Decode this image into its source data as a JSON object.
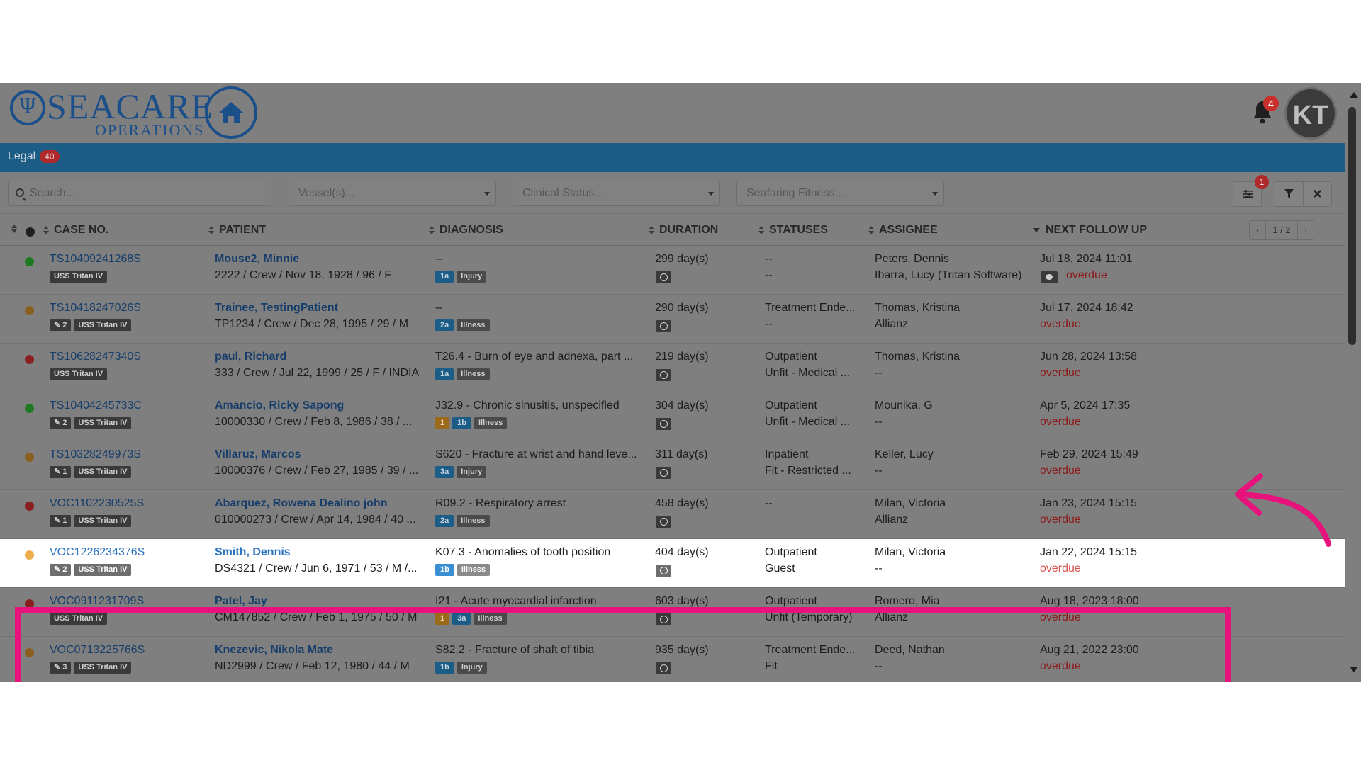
{
  "app": {
    "logo_text": "SEACARE",
    "logo_subtext": "OPERATIONS",
    "notifications_count": "4",
    "avatar_initials": "KT"
  },
  "tabs": [
    {
      "label": "Legal",
      "count": "40"
    }
  ],
  "filters": {
    "search_placeholder": "Search...",
    "vessel_placeholder": "Vessel(s)...",
    "clinical_placeholder": "Clinical Status...",
    "fitness_placeholder": "Seafaring Fitness...",
    "settings_badge": "1"
  },
  "table": {
    "columns": [
      "CASE NO.",
      "PATIENT",
      "DIAGNOSIS",
      "DURATION",
      "STATUSES",
      "ASSIGNEE",
      "NEXT FOLLOW UP"
    ],
    "pager": {
      "label": "1 / 2",
      "prev": "‹",
      "next": "›"
    },
    "rows": [
      {
        "dot_color": "#1e7a1e",
        "case": "TS10409241268S",
        "tags": [
          "USS Tritan IV"
        ],
        "patient": "Mouse2, Minnie",
        "patient_info": "2222 / Crew / Nov 18, 1928 / 96 / F",
        "diagnosis": "--",
        "severity": [
          "1a"
        ],
        "category": "Injury",
        "duration": "299 day(s)",
        "status1": "--",
        "status2": "--",
        "assignee1": "Peters, Dennis",
        "assignee2": "Ibarra, Lucy (Tritan Software)",
        "next_follow_up": "Jul 18, 2024 11:01",
        "overdue": "overdue",
        "has_chat": true
      },
      {
        "dot_color": "#8a5e1f",
        "case": "TS10418247026S",
        "tags": [
          "✎ 2",
          "USS Tritan IV"
        ],
        "patient": "Trainee, TestingPatient",
        "patient_info": "TP1234 / Crew / Dec 28, 1995 / 29 / M",
        "diagnosis": "--",
        "severity": [
          "2a"
        ],
        "category": "Illness",
        "duration": "290 day(s)",
        "status1": "Treatment Ende...",
        "status2": "--",
        "assignee1": "Thomas, Kristina",
        "assignee2": "Allianz",
        "next_follow_up": "Jul 17, 2024 18:42",
        "overdue": "overdue",
        "has_chat": false
      },
      {
        "dot_color": "#8a1f1f",
        "case": "TS10628247340S",
        "tags": [
          "USS Tritan IV"
        ],
        "patient": "paul, Richard",
        "patient_info": "333 / Crew / Jul 22, 1999 / 25 / F / INDIA",
        "diagnosis": "T26.4 - Burn of eye and adnexa, part ...",
        "severity": [
          "1a"
        ],
        "category": "Illness",
        "duration": "219 day(s)",
        "status1": "Outpatient",
        "status2": "Unfit - Medical ...",
        "assignee1": "Thomas, Kristina",
        "assignee2": "--",
        "next_follow_up": "Jun 28, 2024 13:58",
        "overdue": "overdue",
        "has_chat": false
      },
      {
        "dot_color": "#1e7a1e",
        "case": "TS10404245733C",
        "tags": [
          "✎ 2",
          "USS Tritan IV"
        ],
        "patient": "Amancio, Ricky Sapong",
        "patient_info": "10000330 / Crew / Feb 8, 1986 / 38 / ...",
        "diagnosis": "J32.9 - Chronic sinusitis, unspecified",
        "severity": [
          "1",
          "1b"
        ],
        "category": "Illness",
        "duration": "304 day(s)",
        "status1": "Outpatient",
        "status2": "Unfit - Medical ...",
        "assignee1": "Mounika, G",
        "assignee2": "--",
        "next_follow_up": "Apr 5, 2024 17:35",
        "overdue": "overdue",
        "has_chat": false
      },
      {
        "dot_color": "#8a5e1f",
        "case": "TS10328249973S",
        "tags": [
          "✎ 1",
          "USS Tritan IV"
        ],
        "patient": "Villaruz, Marcos",
        "patient_info": "10000376 / Crew / Feb 27, 1985 / 39 / ...",
        "diagnosis": "S620 - Fracture at wrist and hand leve...",
        "severity": [
          "3a"
        ],
        "category": "Injury",
        "duration": "311 day(s)",
        "status1": "Inpatient",
        "status2": "Fit - Restricted ...",
        "assignee1": "Keller, Lucy",
        "assignee2": "--",
        "next_follow_up": "Feb 29, 2024 15:49",
        "overdue": "overdue",
        "has_chat": false
      },
      {
        "dot_color": "#8a1f1f",
        "case": "VOC1102230525S",
        "tags": [
          "✎ 1",
          "USS Tritan IV"
        ],
        "patient": "Abarquez, Rowena Dealino john",
        "patient_info": "010000273 / Crew / Apr 14, 1984 / 40 ...",
        "diagnosis": "R09.2 - Respiratory arrest",
        "severity": [
          "2a"
        ],
        "category": "Illness",
        "duration": "458 day(s)",
        "status1": "--",
        "status2": "",
        "assignee1": "Milan, Victoria",
        "assignee2": "Allianz",
        "next_follow_up": "Jan 23, 2024 15:15",
        "overdue": "overdue",
        "has_chat": false
      },
      {
        "dot_color": "#f0ad4e",
        "case": "VOC1226234376S",
        "tags": [
          "✎ 2",
          "USS Tritan IV"
        ],
        "patient": "Smith, Dennis",
        "patient_info": "DS4321 / Crew / Jun 6, 1971 / 53 / M /...",
        "diagnosis": "K07.3 - Anomalies of tooth position",
        "severity": [
          "1b"
        ],
        "category": "Illness",
        "duration": "404 day(s)",
        "status1": "Outpatient",
        "status2": "Guest",
        "assignee1": "Milan, Victoria",
        "assignee2": "--",
        "next_follow_up": "Jan 22, 2024 15:15",
        "overdue": "overdue",
        "has_chat": false,
        "highlighted": true
      },
      {
        "dot_color": "#8a1f1f",
        "case": "VOC0911231709S",
        "tags": [
          "USS Tritan IV"
        ],
        "patient": "Patel, Jay",
        "patient_info": "CM147852 / Crew / Feb 1, 1975 / 50 / M",
        "diagnosis": "I21 - Acute myocardial infarction",
        "severity": [
          "1",
          "3a"
        ],
        "category": "Illness",
        "duration": "603 day(s)",
        "status1": "Outpatient",
        "status2": "Unfit (Temporary)",
        "assignee1": "Romero, Mia",
        "assignee2": "Allianz",
        "next_follow_up": "Aug 18, 2023 18:00",
        "overdue": "overdue",
        "has_chat": false
      },
      {
        "dot_color": "#8a5e1f",
        "case": "VOC0713225766S",
        "tags": [
          "✎ 3",
          "USS Tritan IV"
        ],
        "patient": "Knezevic, Nikola Mate",
        "patient_info": "ND2999 / Crew / Feb 12, 1980 / 44 / M",
        "diagnosis": "S82.2 - Fracture of shaft of tibia",
        "severity": [
          "1b"
        ],
        "category": "Injury",
        "duration": "935 day(s)",
        "status1": "Treatment Ende...",
        "status2": "Fit",
        "assignee1": "Deed, Nathan",
        "assignee2": "--",
        "next_follow_up": "Aug 21, 2022 23:00",
        "overdue": "overdue",
        "has_chat": false
      }
    ]
  },
  "colors": {
    "annotation": "#e8127c",
    "brand_blue": "#1c5d87",
    "overlay_gray": "#7f7f7f"
  }
}
